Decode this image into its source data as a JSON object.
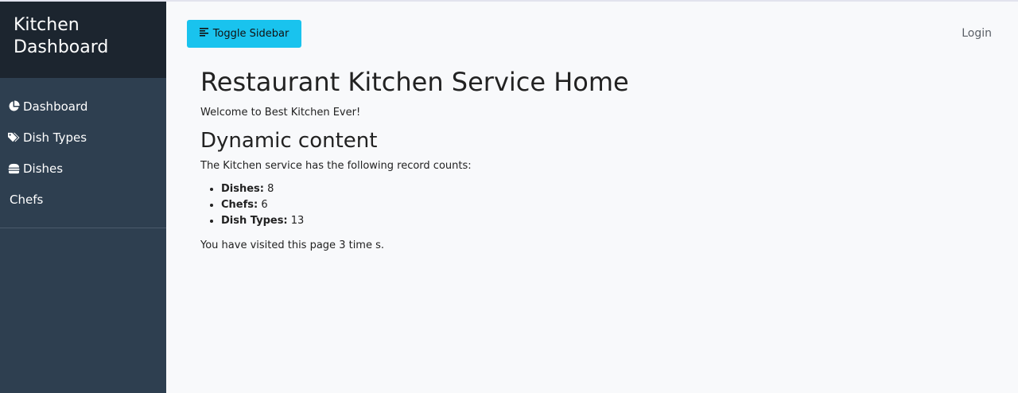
{
  "sidebar": {
    "title": "Kitchen Dashboard",
    "items": [
      {
        "label": "Dashboard",
        "icon": "pie-chart-icon"
      },
      {
        "label": "Dish Types",
        "icon": "tags-icon"
      },
      {
        "label": "Dishes",
        "icon": "hamburger-icon"
      },
      {
        "label": "Chefs",
        "icon": ""
      }
    ]
  },
  "header": {
    "toggle_label": "Toggle Sidebar",
    "toggle_icon": "align-left-icon",
    "login_label": "Login"
  },
  "main": {
    "title": "Restaurant Kitchen Service Home",
    "welcome": "Welcome to Best Kitchen Ever!",
    "section_title": "Dynamic content",
    "record_intro": "The Kitchen service has the following record counts:",
    "records": [
      {
        "label": "Dishes:",
        "value": "8"
      },
      {
        "label": "Chefs:",
        "value": "6"
      },
      {
        "label": "Dish Types:",
        "value": "13"
      }
    ],
    "visits_text": "You have visited this page 3 time s."
  },
  "colors": {
    "sidebar_bg": "#2e3f50",
    "sidebar_header_bg": "#1c252f",
    "accent_button": "#19c3ee",
    "page_bg": "#f8f9fb"
  }
}
